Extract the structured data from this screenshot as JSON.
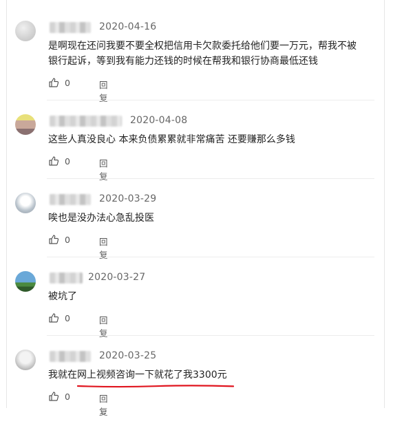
{
  "comments": [
    {
      "date": "2020-04-16",
      "text": "是啊现在还问我要不要全权把信用卡欠款委托给他们要一万元，帮我不被银行起诉，等到我有能力还钱的时候在帮我和银行协商最低还钱",
      "likes": "0",
      "reply_label": "回复"
    },
    {
      "date": "2020-04-08",
      "text": "这些人真没良心 本来负债累累就非常痛苦 还要赚那么多钱",
      "likes": "0",
      "reply_label": "回复"
    },
    {
      "date": "2020-03-29",
      "text": "唉也是没办法心急乱投医",
      "likes": "0",
      "reply_label": "回复"
    },
    {
      "date": "2020-03-27",
      "text": "被坑了",
      "likes": "0",
      "reply_label": "回复"
    },
    {
      "date": "2020-03-25",
      "text": "我就在网上视频咨询一下就花了我3300元",
      "likes": "0",
      "reply_label": "回复"
    }
  ],
  "colors": {
    "annotation_line": "#e0141e",
    "text": "#222222",
    "meta": "#666666"
  },
  "icons": {
    "like": "thumbs-up-icon"
  }
}
